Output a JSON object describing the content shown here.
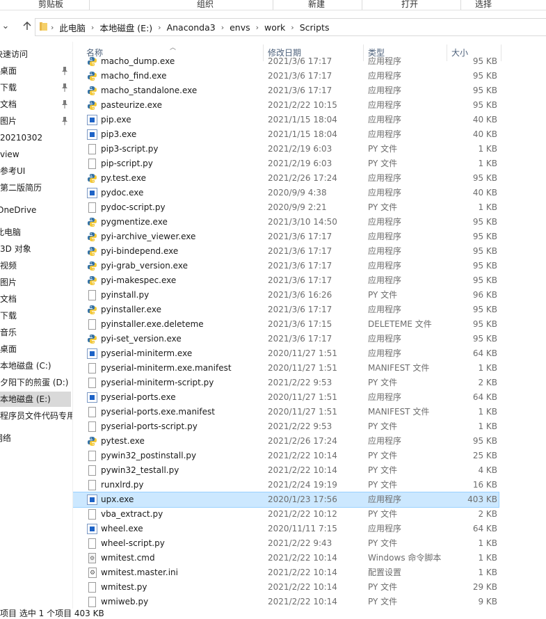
{
  "ribbon": {
    "groups": [
      "剪贴板",
      "组织",
      "新建",
      "打开",
      "选择"
    ]
  },
  "address": {
    "crumbs": [
      "此电脑",
      "本地磁盘 (E:)",
      "Anaconda3",
      "envs",
      "work",
      "Scripts"
    ]
  },
  "nav": {
    "items": [
      {
        "label": "快速访问",
        "pinned": false
      },
      {
        "label": "桌面",
        "pinned": true
      },
      {
        "label": "下载",
        "pinned": true
      },
      {
        "label": "文档",
        "pinned": true
      },
      {
        "label": "图片",
        "pinned": true
      },
      {
        "label": "20210302",
        "pinned": false
      },
      {
        "label": "view",
        "pinned": false
      },
      {
        "label": "参考UI",
        "pinned": false
      },
      {
        "label": "第二版简历",
        "pinned": false
      },
      {
        "label": "OneDrive",
        "pinned": false
      },
      {
        "label": "此电脑",
        "pinned": false
      },
      {
        "label": "3D 对象",
        "pinned": false
      },
      {
        "label": "视频",
        "pinned": false
      },
      {
        "label": "图片",
        "pinned": false
      },
      {
        "label": "文档",
        "pinned": false
      },
      {
        "label": "下载",
        "pinned": false
      },
      {
        "label": "音乐",
        "pinned": false
      },
      {
        "label": "桌面",
        "pinned": false
      },
      {
        "label": "本地磁盘 (C:)",
        "pinned": false
      },
      {
        "label": "夕阳下的煎蛋 (D:)",
        "pinned": false
      },
      {
        "label": "本地磁盘 (E:)",
        "pinned": false,
        "selected": true
      },
      {
        "label": "程序员文件代码专用",
        "pinned": false
      },
      {
        "label": "网络",
        "pinned": false
      }
    ]
  },
  "columns": {
    "name": "名称",
    "date": "修改日期",
    "type": "类型",
    "size": "大小"
  },
  "files": [
    {
      "name": "macho_dump.exe",
      "date": "2021/3/6 17:17",
      "type": "应用程序",
      "size": "95 KB",
      "icon": "python-exe-icon"
    },
    {
      "name": "macho_find.exe",
      "date": "2021/3/6 17:17",
      "type": "应用程序",
      "size": "95 KB",
      "icon": "python-exe-icon"
    },
    {
      "name": "macho_standalone.exe",
      "date": "2021/3/6 17:17",
      "type": "应用程序",
      "size": "95 KB",
      "icon": "python-exe-icon"
    },
    {
      "name": "pasteurize.exe",
      "date": "2021/2/22 10:15",
      "type": "应用程序",
      "size": "95 KB",
      "icon": "python-exe-icon"
    },
    {
      "name": "pip.exe",
      "date": "2021/1/15 18:04",
      "type": "应用程序",
      "size": "40 KB",
      "icon": "app-window-icon"
    },
    {
      "name": "pip3.exe",
      "date": "2021/1/15 18:04",
      "type": "应用程序",
      "size": "40 KB",
      "icon": "app-window-icon"
    },
    {
      "name": "pip3-script.py",
      "date": "2021/2/19 6:03",
      "type": "PY 文件",
      "size": "1 KB",
      "icon": "document-icon"
    },
    {
      "name": "pip-script.py",
      "date": "2021/2/19 6:03",
      "type": "PY 文件",
      "size": "1 KB",
      "icon": "document-icon"
    },
    {
      "name": "py.test.exe",
      "date": "2021/2/26 17:24",
      "type": "应用程序",
      "size": "95 KB",
      "icon": "python-exe-icon"
    },
    {
      "name": "pydoc.exe",
      "date": "2020/9/9 4:38",
      "type": "应用程序",
      "size": "40 KB",
      "icon": "app-window-icon"
    },
    {
      "name": "pydoc-script.py",
      "date": "2020/9/9 2:21",
      "type": "PY 文件",
      "size": "1 KB",
      "icon": "document-icon"
    },
    {
      "name": "pygmentize.exe",
      "date": "2021/3/10 14:50",
      "type": "应用程序",
      "size": "95 KB",
      "icon": "python-exe-icon"
    },
    {
      "name": "pyi-archive_viewer.exe",
      "date": "2021/3/6 17:17",
      "type": "应用程序",
      "size": "95 KB",
      "icon": "python-exe-icon"
    },
    {
      "name": "pyi-bindepend.exe",
      "date": "2021/3/6 17:17",
      "type": "应用程序",
      "size": "95 KB",
      "icon": "python-exe-icon"
    },
    {
      "name": "pyi-grab_version.exe",
      "date": "2021/3/6 17:17",
      "type": "应用程序",
      "size": "95 KB",
      "icon": "python-exe-icon"
    },
    {
      "name": "pyi-makespec.exe",
      "date": "2021/3/6 17:17",
      "type": "应用程序",
      "size": "95 KB",
      "icon": "python-exe-icon"
    },
    {
      "name": "pyinstall.py",
      "date": "2021/3/6 16:26",
      "type": "PY 文件",
      "size": "96 KB",
      "icon": "document-icon"
    },
    {
      "name": "pyinstaller.exe",
      "date": "2021/3/6 17:17",
      "type": "应用程序",
      "size": "95 KB",
      "icon": "python-exe-icon"
    },
    {
      "name": "pyinstaller.exe.deleteme",
      "date": "2021/3/6 17:15",
      "type": "DELETEME 文件",
      "size": "95 KB",
      "icon": "document-icon"
    },
    {
      "name": "pyi-set_version.exe",
      "date": "2021/3/6 17:17",
      "type": "应用程序",
      "size": "95 KB",
      "icon": "python-exe-icon"
    },
    {
      "name": "pyserial-miniterm.exe",
      "date": "2020/11/27 1:51",
      "type": "应用程序",
      "size": "64 KB",
      "icon": "app-window-icon"
    },
    {
      "name": "pyserial-miniterm.exe.manifest",
      "date": "2020/11/27 1:51",
      "type": "MANIFEST 文件",
      "size": "1 KB",
      "icon": "document-icon"
    },
    {
      "name": "pyserial-miniterm-script.py",
      "date": "2021/2/22 9:53",
      "type": "PY 文件",
      "size": "2 KB",
      "icon": "document-icon"
    },
    {
      "name": "pyserial-ports.exe",
      "date": "2020/11/27 1:51",
      "type": "应用程序",
      "size": "64 KB",
      "icon": "app-window-icon"
    },
    {
      "name": "pyserial-ports.exe.manifest",
      "date": "2020/11/27 1:51",
      "type": "MANIFEST 文件",
      "size": "1 KB",
      "icon": "document-icon"
    },
    {
      "name": "pyserial-ports-script.py",
      "date": "2021/2/22 9:53",
      "type": "PY 文件",
      "size": "1 KB",
      "icon": "document-icon"
    },
    {
      "name": "pytest.exe",
      "date": "2021/2/26 17:24",
      "type": "应用程序",
      "size": "95 KB",
      "icon": "python-exe-icon"
    },
    {
      "name": "pywin32_postinstall.py",
      "date": "2021/2/22 10:14",
      "type": "PY 文件",
      "size": "25 KB",
      "icon": "document-icon"
    },
    {
      "name": "pywin32_testall.py",
      "date": "2021/2/22 10:14",
      "type": "PY 文件",
      "size": "4 KB",
      "icon": "document-icon"
    },
    {
      "name": "runxlrd.py",
      "date": "2021/2/24 19:19",
      "type": "PY 文件",
      "size": "16 KB",
      "icon": "document-icon"
    },
    {
      "name": "upx.exe",
      "date": "2020/1/23 17:56",
      "type": "应用程序",
      "size": "403 KB",
      "icon": "app-window-icon",
      "selected": true
    },
    {
      "name": "vba_extract.py",
      "date": "2021/2/22 10:12",
      "type": "PY 文件",
      "size": "2 KB",
      "icon": "document-icon"
    },
    {
      "name": "wheel.exe",
      "date": "2020/11/11 7:15",
      "type": "应用程序",
      "size": "64 KB",
      "icon": "app-window-icon"
    },
    {
      "name": "wheel-script.py",
      "date": "2021/2/22 9:43",
      "type": "PY 文件",
      "size": "1 KB",
      "icon": "document-icon"
    },
    {
      "name": "wmitest.cmd",
      "date": "2021/2/22 10:14",
      "type": "Windows 命令脚本",
      "size": "1 KB",
      "icon": "command-script-icon"
    },
    {
      "name": "wmitest.master.ini",
      "date": "2021/2/22 10:14",
      "type": "配置设置",
      "size": "1 KB",
      "icon": "config-settings-icon"
    },
    {
      "name": "wmitest.py",
      "date": "2021/2/22 10:14",
      "type": "PY 文件",
      "size": "29 KB",
      "icon": "document-icon"
    },
    {
      "name": "wmiweb.py",
      "date": "2021/2/22 10:14",
      "type": "PY 文件",
      "size": "9 KB",
      "icon": "document-icon"
    }
  ],
  "status": {
    "text": "项目    选中 1 个项目  403 KB"
  },
  "colors": {
    "selection_bg": "#cce8ff",
    "selection_border": "#99d1ff",
    "header_text": "#4c607a",
    "meta_text": "#6d6d6d"
  }
}
